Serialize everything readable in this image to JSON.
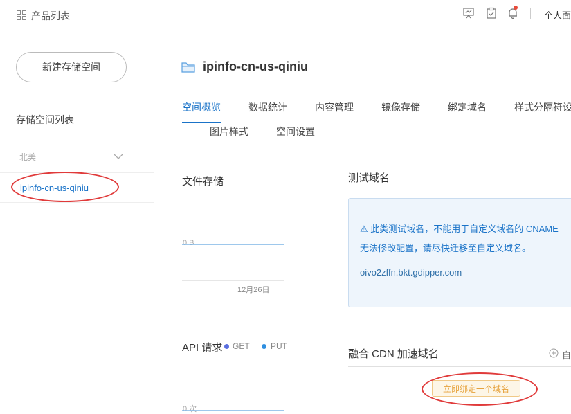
{
  "header": {
    "breadcrumb": "产品列表",
    "user_label": "个人面"
  },
  "sidebar": {
    "new_button": "新建存储空间",
    "list_title": "存储空间列表",
    "region": "北美",
    "bucket": "ipinfo-cn-us-qiniu"
  },
  "main": {
    "bucket_title": "ipinfo-cn-us-qiniu",
    "tabs": [
      {
        "label": "空间概览"
      },
      {
        "label": "数据统计"
      },
      {
        "label": "内容管理"
      },
      {
        "label": "镜像存储"
      },
      {
        "label": "绑定域名"
      },
      {
        "label": "样式分隔符设"
      },
      {
        "label": "图片样式"
      },
      {
        "label": "空间设置"
      }
    ],
    "active_tab": "空间概览"
  },
  "storage": {
    "title": "文件存储",
    "value": "0 B",
    "date": "12月26日"
  },
  "api": {
    "title": "API 请求",
    "legend": [
      {
        "label": "GET",
        "color": "#5b6fe0"
      },
      {
        "label": "PUT",
        "color": "#2f8fe0"
      }
    ],
    "value": "0 次"
  },
  "test_domain": {
    "title": "测试域名",
    "notice_line1": "⚠ 此类测试域名，不能用于自定义域名的 CNAME",
    "notice_line2": "无法修改配置，请尽快迁移至自定义域名。",
    "domain": "oivo2zffn.bkt.gdipper.com"
  },
  "cdn": {
    "title": "融合 CDN 加速域名",
    "add_label": "自",
    "bind_button": "立即绑定一个域名"
  },
  "colors": {
    "accent": "#1a73c8",
    "highlight_circle": "#e03a3a",
    "warning_button": "#e6a23c"
  }
}
